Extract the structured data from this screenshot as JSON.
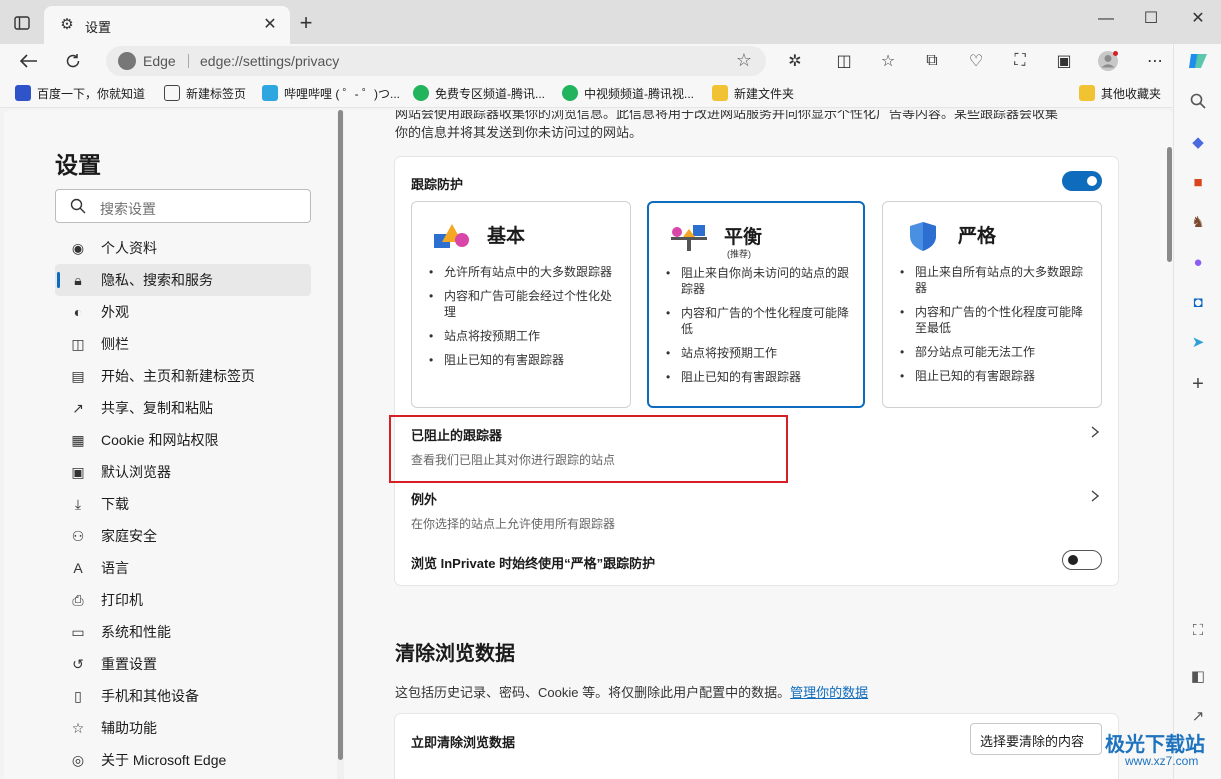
{
  "browser": {
    "tab_title": "设置",
    "omnibox": {
      "edge_label": "Edge",
      "url": "edge://settings/privacy"
    }
  },
  "bookmarks": [
    {
      "label": "百度一下，你就知道",
      "icon": "baidu-paw-icon"
    },
    {
      "label": "新建标签页",
      "icon": "new-tab-icon"
    },
    {
      "label": "哔哩哔哩 ( ゜- ゜)つ...",
      "icon": "bilibili-icon"
    },
    {
      "label": "免费专区频道-腾讯...",
      "icon": "tencent-video-icon"
    },
    {
      "label": "中视频频道-腾讯视...",
      "icon": "tencent-video-icon"
    },
    {
      "label": "新建文件夹",
      "icon": "folder-icon"
    },
    {
      "label": "其他收藏夹",
      "icon": "folder-icon"
    }
  ],
  "sidebar": {
    "title": "设置",
    "search_placeholder": "搜索设置",
    "items": [
      {
        "label": "个人资料",
        "icon": "profile-icon"
      },
      {
        "label": "隐私、搜索和服务",
        "icon": "lock-icon",
        "active": true
      },
      {
        "label": "外观",
        "icon": "palette-icon"
      },
      {
        "label": "侧栏",
        "icon": "sidebar-icon"
      },
      {
        "label": "开始、主页和新建标签页",
        "icon": "home-icon"
      },
      {
        "label": "共享、复制和粘贴",
        "icon": "share-icon"
      },
      {
        "label": "Cookie 和网站权限",
        "icon": "cookie-icon"
      },
      {
        "label": "默认浏览器",
        "icon": "browser-icon"
      },
      {
        "label": "下载",
        "icon": "download-icon"
      },
      {
        "label": "家庭安全",
        "icon": "family-icon"
      },
      {
        "label": "语言",
        "icon": "language-icon"
      },
      {
        "label": "打印机",
        "icon": "printer-icon"
      },
      {
        "label": "系统和性能",
        "icon": "laptop-icon"
      },
      {
        "label": "重置设置",
        "icon": "reset-icon"
      },
      {
        "label": "手机和其他设备",
        "icon": "phone-icon"
      },
      {
        "label": "辅助功能",
        "icon": "accessibility-icon"
      },
      {
        "label": "关于 Microsoft Edge",
        "icon": "edge-icon"
      }
    ]
  },
  "main": {
    "intro_line1": "网站会使用跟踪器收集你的浏览信息。此信息将用于改进网站服务并向你显示个性化广告等内容。某些跟踪器会收集",
    "intro_line2": "你的信息并将其发送到你未访问过的网站。",
    "tracking": {
      "title": "跟踪防护",
      "enabled": true,
      "options": [
        {
          "title": "基本",
          "subtitle": "",
          "bullets": [
            "允许所有站点中的大多数跟踪器",
            "内容和广告可能会经过个性化处理",
            "站点将按预期工作",
            "阻止已知的有害跟踪器"
          ]
        },
        {
          "title": "平衡",
          "subtitle": "(推荐)",
          "selected": true,
          "bullets": [
            "阻止来自你尚未访问的站点的跟踪器",
            "内容和广告的个性化程度可能降低",
            "站点将按预期工作",
            "阻止已知的有害跟踪器"
          ]
        },
        {
          "title": "严格",
          "subtitle": "",
          "bullets": [
            "阻止来自所有站点的大多数跟踪器",
            "内容和广告的个性化程度可能降至最低",
            "部分站点可能无法工作",
            "阻止已知的有害跟踪器"
          ]
        }
      ],
      "blocked_title": "已阻止的跟踪器",
      "blocked_sub": "查看我们已阻止其对你进行跟踪的站点",
      "exceptions_title": "例外",
      "exceptions_sub": "在你选择的站点上允许使用所有跟踪器",
      "inprivate_label": "浏览 InPrivate 时始终使用“严格”跟踪防护",
      "inprivate_enabled": false
    },
    "clear": {
      "heading": "清除浏览数据",
      "desc": "这包括历史记录、密码、Cookie 等。将仅删除此用户配置中的数据。",
      "link": "管理你的数据",
      "now_label": "立即清除浏览数据",
      "choose_button": "选择要清除的内容"
    }
  },
  "watermark": {
    "line1": "极光下载站",
    "line2": "www.xz7.com"
  },
  "colors": {
    "accent": "#0f6cbd",
    "highlight_box": "#d81f26"
  }
}
